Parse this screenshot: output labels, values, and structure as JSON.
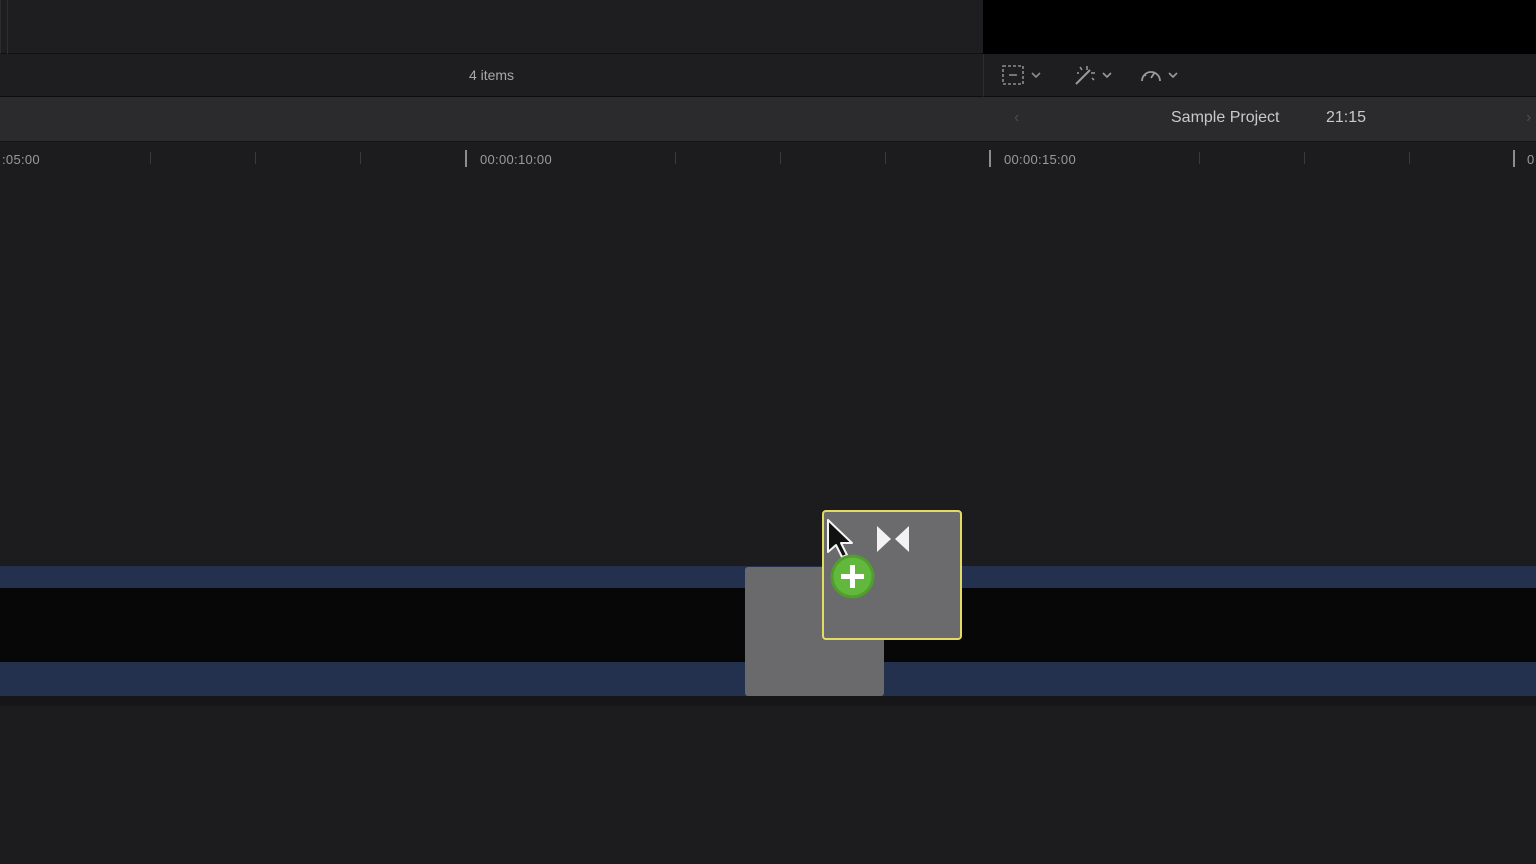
{
  "browser": {
    "item_count": "4 items"
  },
  "viewer_toolbar": {
    "icons": [
      "clip-appearance-icon",
      "enhance-wand-icon",
      "retime-speed-icon"
    ]
  },
  "timeline": {
    "project_name": "Sample Project",
    "project_duration": "21:15",
    "nav_back": "‹",
    "nav_forward": "›",
    "ruler_labels": [
      ":05:00",
      "00:00:10:00",
      "00:00:15:00",
      "0"
    ]
  },
  "colors": {
    "track_blue": "#23304e",
    "drag_outline": "#e2dc62",
    "add_badge": "#5db638"
  }
}
